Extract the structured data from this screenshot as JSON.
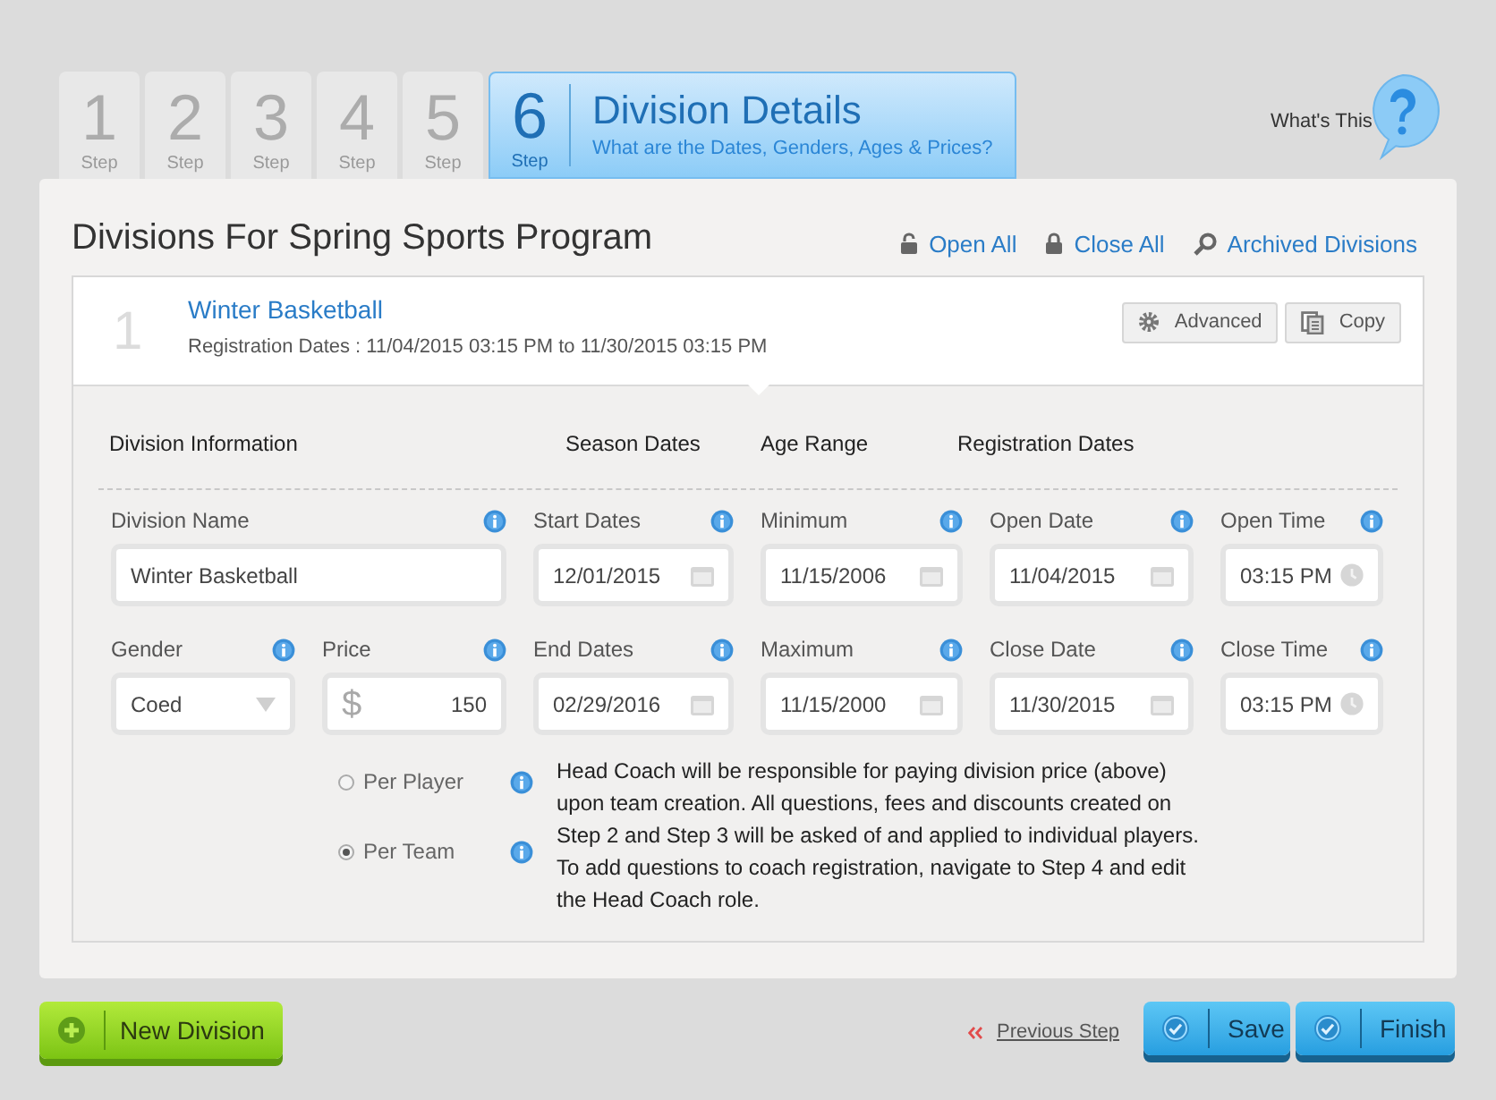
{
  "steps": [
    {
      "number": "1",
      "label": "Step",
      "selected": false
    },
    {
      "number": "2",
      "label": "Step",
      "selected": false
    },
    {
      "number": "3",
      "label": "Step",
      "selected": false
    },
    {
      "number": "4",
      "label": "Step",
      "selected": false
    },
    {
      "number": "5",
      "label": "Step",
      "selected": false
    },
    {
      "number": "6",
      "label": "Step",
      "selected": true,
      "title": "Division Details",
      "subtitle": "What are the Dates, Genders, Ages & Prices?"
    }
  ],
  "help": {
    "label": "What's This"
  },
  "panel": {
    "title": "Divisions For Spring Sports Program",
    "actions": [
      {
        "label": "Open All",
        "kind": "unlock"
      },
      {
        "label": "Close All",
        "kind": "lock"
      },
      {
        "label": "Archived Divisions",
        "kind": "search"
      }
    ]
  },
  "division": {
    "index": "1",
    "name": "Winter Basketball",
    "registration": "Registration Dates : 11/04/2015 03:15 PM to 11/30/2015 03:15 PM",
    "buttons": [
      {
        "label": "Advanced",
        "kind": "gear"
      },
      {
        "label": "Copy",
        "kind": "copy"
      }
    ]
  },
  "section_headings": [
    "Division Information",
    "Season Dates",
    "Age Range",
    "Registration Dates"
  ],
  "field_rows": [
    [
      {
        "label": "Division Name",
        "kind": "text",
        "value": "Winter Basketball"
      },
      {
        "label": "Start Dates",
        "kind": "date",
        "value": "12/01/2015"
      },
      {
        "label": "Minimum",
        "kind": "date",
        "value": "11/15/2006"
      },
      {
        "label": "Open Date",
        "kind": "date",
        "value": "11/04/2015"
      },
      {
        "label": "Open Time",
        "kind": "time",
        "value": "03:15 PM"
      }
    ],
    [
      {
        "label": "Gender",
        "kind": "select",
        "value": "Coed"
      },
      {
        "label": "Price",
        "kind": "price",
        "prefix": "$",
        "value": "150"
      },
      {
        "label": "End Dates",
        "kind": "date",
        "value": "02/29/2016"
      },
      {
        "label": "Maximum",
        "kind": "date",
        "value": "11/15/2000"
      },
      {
        "label": "Close Date",
        "kind": "date",
        "value": "11/30/2015"
      },
      {
        "label": "Close Time",
        "kind": "time",
        "value": "03:15 PM"
      }
    ]
  ],
  "payment": {
    "options": [
      {
        "label": "Per Player",
        "selected": false
      },
      {
        "label": "Per Team",
        "selected": true
      }
    ],
    "note": "Head Coach will be responsible for paying division price (above) upon team creation. All questions, fees and discounts created on Step 2 and Step 3 will be asked of and applied to individual players. To add questions to coach registration, navigate to Step 4 and edit the Head Coach role."
  },
  "footer": {
    "new_division": "New Division",
    "previous_step": "Previous Step",
    "buttons": [
      "Save",
      "Finish"
    ]
  }
}
